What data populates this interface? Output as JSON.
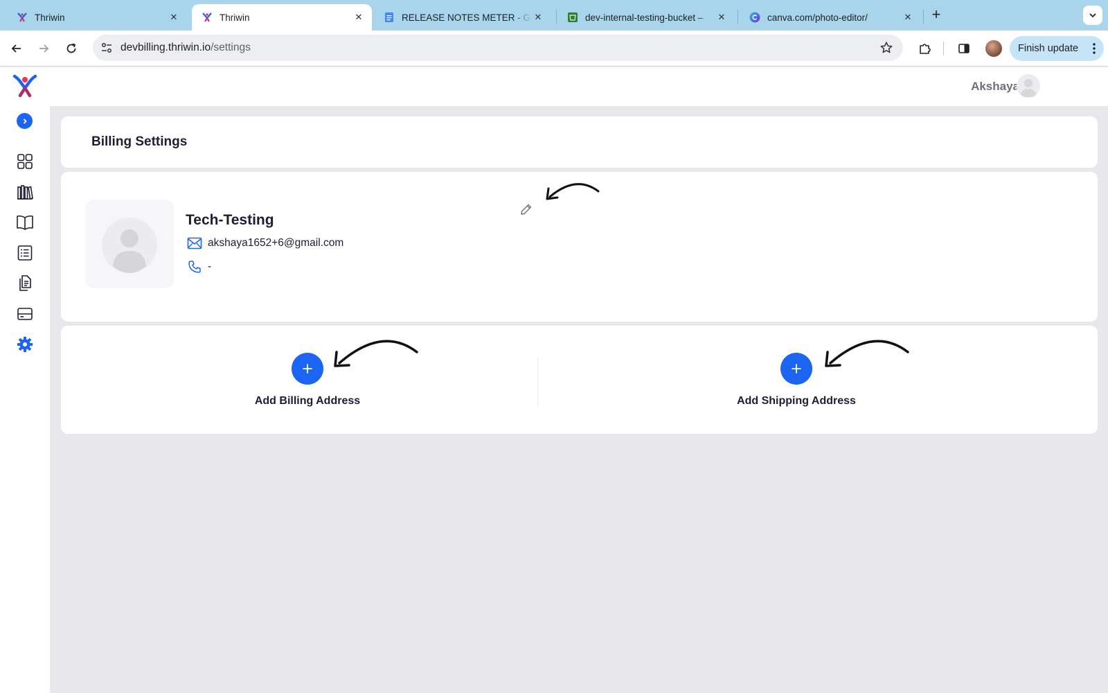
{
  "browser": {
    "tabs": [
      {
        "title": "Thriwin",
        "favicon": "thriwin-logo-icon",
        "active": false
      },
      {
        "title": "Thriwin",
        "favicon": "thriwin-logo-icon",
        "active": true
      },
      {
        "title": "RELEASE NOTES METER - Go",
        "favicon": "google-docs-icon",
        "active": false
      },
      {
        "title": "dev-internal-testing-bucket –",
        "favicon": "bucket-icon",
        "active": false
      },
      {
        "title": "canva.com/photo-editor/",
        "favicon": "canva-icon",
        "active": false
      }
    ],
    "close_glyph": "✕",
    "new_tab_glyph": "+",
    "url_host": "devbilling.thriwin.io",
    "url_path": "/settings",
    "finish_update_label": "Finish update"
  },
  "header": {
    "user_name": "Akshaya"
  },
  "sidebar": {
    "items": [
      {
        "icon": "dashboard-grid-icon",
        "active": false
      },
      {
        "icon": "library-icon",
        "active": false
      },
      {
        "icon": "book-icon",
        "active": false
      },
      {
        "icon": "list-icon",
        "active": false
      },
      {
        "icon": "documents-icon",
        "active": false
      },
      {
        "icon": "card-icon",
        "active": false
      },
      {
        "icon": "gear-icon",
        "active": true
      }
    ]
  },
  "page": {
    "title": "Billing Settings"
  },
  "profile": {
    "company_name": "Tech-Testing",
    "email": "akshaya1652+6@gmail.com",
    "phone": "-"
  },
  "addresses": {
    "add_billing_label": "Add Billing Address",
    "add_shipping_label": "Add Shipping Address",
    "plus_glyph": "+"
  },
  "colors": {
    "accent": "#1c64f2",
    "tab_strip": "#a8d4ec",
    "page_background": "#e8e7ec",
    "heading_text": "#1d1d35"
  }
}
